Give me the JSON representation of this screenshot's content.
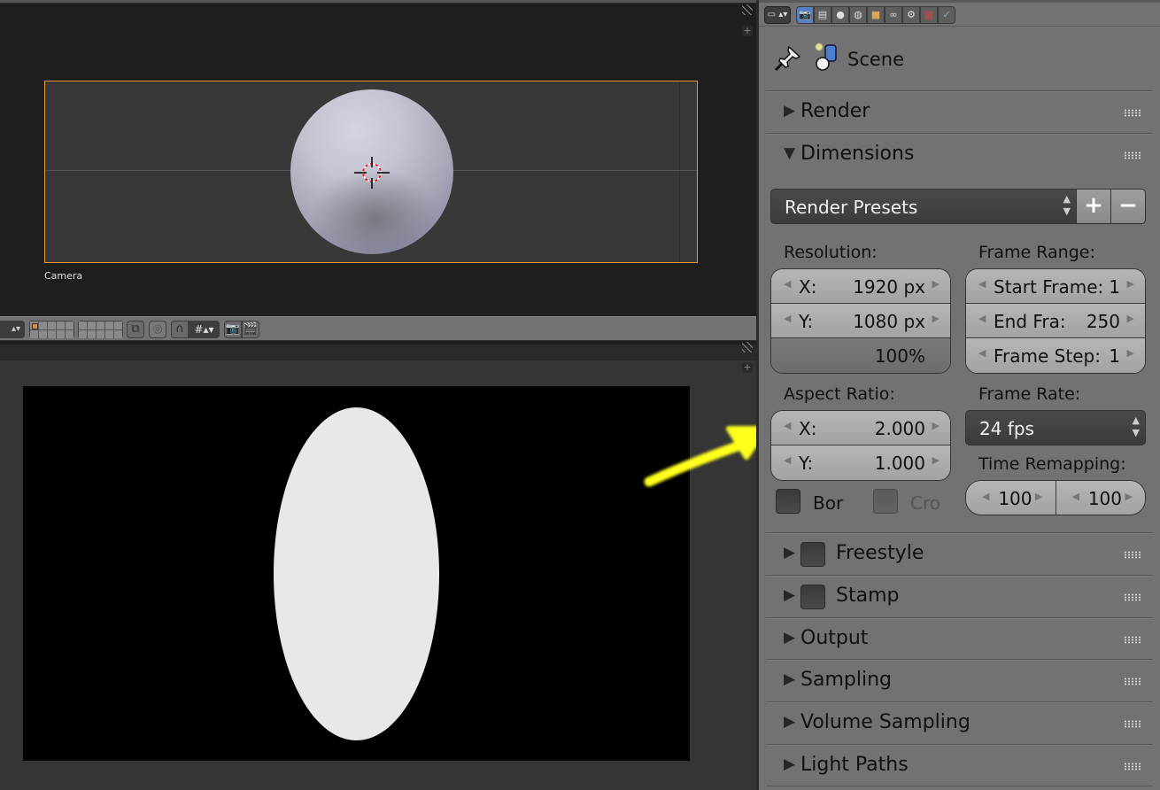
{
  "viewport3d": {
    "camera_label": "Camera",
    "header": {
      "editor_type_icon": "view3d-editor-icon",
      "layer_groups": 2,
      "buttons": [
        "layer-lock-icon",
        "proportional-edit-icon",
        "snap-magnet-icon",
        "snap-element-icon",
        "opengl-render-icon",
        "opengl-render-animation-icon"
      ]
    }
  },
  "image_editor": {
    "content": "rendered-ellipse"
  },
  "annotation": {
    "type": "arrow",
    "color": "#ffff1a",
    "points_to": "aspect-ratio"
  },
  "properties": {
    "tabs": [
      {
        "name": "render",
        "icon": "camera-render-icon",
        "active": true
      },
      {
        "name": "render-layers",
        "icon": "render-layers-icon",
        "active": false
      },
      {
        "name": "scene",
        "icon": "scene-icon",
        "active": false
      },
      {
        "name": "world",
        "icon": "world-icon",
        "active": false
      },
      {
        "name": "object",
        "icon": "object-cube-icon",
        "active": false
      },
      {
        "name": "constraints",
        "icon": "constraints-link-icon",
        "active": false
      },
      {
        "name": "modifiers",
        "icon": "modifiers-icon",
        "active": false
      },
      {
        "name": "texture",
        "icon": "texture-checker-icon",
        "active": false
      },
      {
        "name": "particles",
        "icon": "particles-icon",
        "active": false
      }
    ],
    "context": {
      "scene_name": "Scene"
    },
    "panels": {
      "render": {
        "label": "Render",
        "expanded": false
      },
      "dimensions": {
        "label": "Dimensions",
        "expanded": true
      },
      "freestyle": {
        "label": "Freestyle",
        "expanded": false,
        "checked": false
      },
      "stamp": {
        "label": "Stamp",
        "expanded": false,
        "checked": false
      },
      "output": {
        "label": "Output",
        "expanded": false
      },
      "sampling": {
        "label": "Sampling",
        "expanded": false
      },
      "volume_sampling": {
        "label": "Volume Sampling",
        "expanded": false
      },
      "light_paths": {
        "label": "Light Paths",
        "expanded": false
      }
    },
    "dimensions": {
      "render_presets": "Render Presets",
      "add_preset": "+",
      "remove_preset": "−",
      "resolution_label": "Resolution:",
      "res_x_label": "X:",
      "res_x_value": "1920 px",
      "res_y_label": "Y:",
      "res_y_value": "1080 px",
      "res_percent": "100%",
      "frame_range_label": "Frame Range:",
      "start_frame_label": "Start Frame:",
      "start_frame_value": "1",
      "end_frame_label": "End Fra:",
      "end_frame_value": "250",
      "frame_step_label": "Frame Step:",
      "frame_step_value": "1",
      "aspect_label": "Aspect Ratio:",
      "aspect_x_label": "X:",
      "aspect_x_value": "2.000",
      "aspect_y_label": "Y:",
      "aspect_y_value": "1.000",
      "frame_rate_label": "Frame Rate:",
      "frame_rate_value": "24 fps",
      "border_label": "Bor",
      "border_checked": false,
      "crop_label": "Cro",
      "crop_checked": false,
      "crop_enabled": false,
      "time_remap_label": "Time Remapping:",
      "time_remap_old": "100",
      "time_remap_new": "100"
    }
  }
}
